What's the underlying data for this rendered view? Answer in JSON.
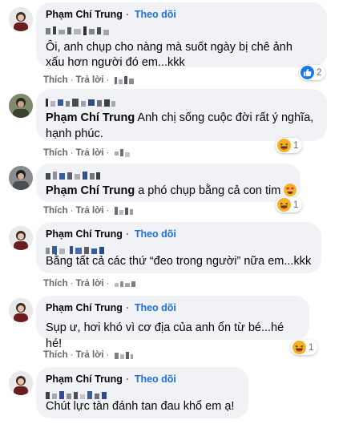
{
  "colors": {
    "bubble": "#f0f2f5",
    "link": "#216fdb",
    "muted": "#65676b",
    "like": "#1877f2",
    "haha": "#f7b125"
  },
  "comments": [
    {
      "author": "Phạm Chí Trung",
      "follow": "Theo dõi",
      "mention_blurred": true,
      "text_line1": "Ôi, anh chụp cho nàng mà suốt ngày bị chê ảnh",
      "text_line2": "xấu hơn người đó em...kkk",
      "like": "Thích",
      "reply": "Trả lời",
      "reaction": {
        "icon": "like-icon",
        "count": "2"
      }
    },
    {
      "author_blurred": true,
      "mention": "Phạm Chí Trung",
      "text_line1": " Anh chị sống cuộc đời rất ý nghĩa,",
      "text_line2": "hạnh phúc.",
      "like": "Thích",
      "reply": "Trả lời",
      "reaction": {
        "icon": "haha-icon",
        "count": "1"
      }
    },
    {
      "author_blurred": true,
      "mention": "Phạm Chí Trung",
      "text_line1": " a phó chụp bằng cả con tim",
      "emoji": "heart-eyes-emoji",
      "like": "Thích",
      "reply": "Trả lời",
      "reaction": {
        "icon": "haha-icon",
        "count": "1"
      }
    },
    {
      "author": "Phạm Chí Trung",
      "follow": "Theo dõi",
      "mention_blurred": true,
      "text_line1": "Bằng tất cả các thứ “đeo trong người” nữa em...kkk",
      "like": "Thích",
      "reply": "Trả lời"
    },
    {
      "author": "Phạm Chí Trung",
      "follow": "Theo dõi",
      "text_line1": "Sụp ư, hơi khó vì cơ địa của anh ổn từ bé...hé hé!",
      "like": "Thích",
      "reply": "Trả lời",
      "reaction": {
        "icon": "haha-icon",
        "count": "1"
      }
    },
    {
      "author": "Phạm Chí Trung",
      "follow": "Theo dõi",
      "mention_blurred": true,
      "text_line1": "Chút lực tàn đánh tan đau khổ em ạ!"
    }
  ]
}
